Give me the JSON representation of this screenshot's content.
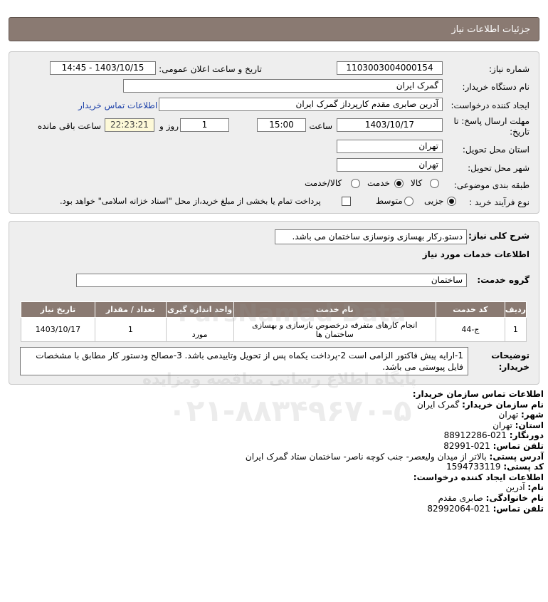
{
  "header": {
    "title": "جزئیات اطلاعات نیاز"
  },
  "form": {
    "need_number_label": "شماره نیاز:",
    "need_number": "1103003004000154",
    "announce_label": "تاریخ و ساعت اعلان عمومی:",
    "announce_value": "1403/10/15 - 14:45",
    "buyer_org_label": "نام دستگاه خریدار:",
    "buyer_org": "گمرک ایران",
    "creator_label": "ایجاد کننده درخواست:",
    "creator": "آدرین صابری مقدم کارپرداز گمرک ایران",
    "contact_link": "اطلاعات تماس خریدار",
    "deadline_label_1": "مهلت ارسال پاسخ: تا",
    "deadline_label_2": "تاریخ:",
    "deadline_date": "1403/10/17",
    "time_label": "ساعت",
    "deadline_time": "15:00",
    "days_value": "1",
    "days_label": "روز و",
    "remaining_time": "22:23:21",
    "remaining_label": "ساعت باقی مانده",
    "province_label": "استان محل تحویل:",
    "province": "تهران",
    "city_label": "شهر محل تحویل:",
    "city": "تهران",
    "category_label": "طبقه بندی موضوعی:",
    "category_options": [
      "کالا",
      "خدمت",
      "کالا/خدمت"
    ],
    "category_selected": "خدمت",
    "process_label": "نوع فرآیند خرید :",
    "process_options": [
      "جزیی",
      "متوسط"
    ],
    "process_selected": "جزیی",
    "treasury_text": "پرداخت تمام یا بخشی از مبلغ خرید،از محل \"اسناد خزانه اسلامی\" خواهد بود."
  },
  "details": {
    "summary_label": "شرح کلی نیاز:",
    "summary": "دستو.رکار بهسازی ونوسازی ساختمان می باشد.",
    "services_title": "اطلاعات خدمات مورد نیاز",
    "service_group_label": "گروه خدمت:",
    "service_group": "ساختمان",
    "table": {
      "headers": [
        "ردیف",
        "کد خدمت",
        "نام خدمت",
        "واحد اندازه گیری",
        "تعداد / مقدار",
        "تاریخ نیاز"
      ],
      "rows": [
        [
          "1",
          "ج-44",
          "انجام کارهای متفرقه درخصوص بازسازی و بهسازی ساختمان ها",
          "مورد",
          "1",
          "1403/10/17"
        ]
      ]
    },
    "buyer_notes_label_1": "توضیحات",
    "buyer_notes_label_2": "خریدار:",
    "buyer_notes": "1-ارایه پیش فاکتور الزامی است 2-پرداخت یکماه پس از تحویل وتاییدمی باشد. 3-مصالح ودستور کار مطابق با مشخصات فایل پیوستی می باشد."
  },
  "contact": {
    "lines": [
      {
        "label": "اطلاعات تماس سازمان خریدار:",
        "value": ""
      },
      {
        "label": "نام سازمان خریدار:",
        "value": "گمرک ایران"
      },
      {
        "label": "شهر:",
        "value": "تهران"
      },
      {
        "label": "استان:",
        "value": "تهران"
      },
      {
        "label": "دورنگار:",
        "value": "021-88912286"
      },
      {
        "label": "تلفن تماس:",
        "value": "021-82991"
      },
      {
        "label": "آدرس پستی:",
        "value": "بالاتر از میدان ولیعصر- جنب کوچه ناصر- ساختمان ستاد گمرک ایران"
      },
      {
        "label": "کد پستی:",
        "value": "1594733119"
      },
      {
        "label": "اطلاعات ایجاد کننده درخواست:",
        "value": ""
      },
      {
        "label": "نام:",
        "value": "آدرین"
      },
      {
        "label": "نام خانوادگی:",
        "value": "صابری مقدم"
      },
      {
        "label": "تلفن تماس:",
        "value": "021-82992064"
      }
    ]
  },
  "watermark": {
    "line1": "پایگاه اطلاع رسانی مناقصه ومزایده",
    "line2": "۰۲۱-۸۸۳۴۹۶۷۰-۵",
    "brand": "ParsNamad Data"
  }
}
